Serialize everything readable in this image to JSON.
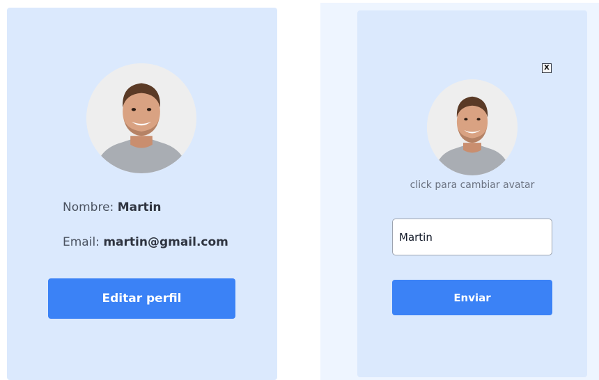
{
  "profile_card": {
    "name_label": "Nombre:",
    "name_value": "Martin",
    "email_label": "Email:",
    "email_value": "martin@gmail.com",
    "edit_button": "Editar perfil"
  },
  "edit_modal": {
    "close_label": "X",
    "avatar_hint": "click para cambiar avatar",
    "name_input_value": "Martin",
    "submit_button": "Enviar"
  },
  "colors": {
    "card_background": "#dbe9fd",
    "panel_background": "#eef5ff",
    "primary_button": "#3b82f6"
  }
}
